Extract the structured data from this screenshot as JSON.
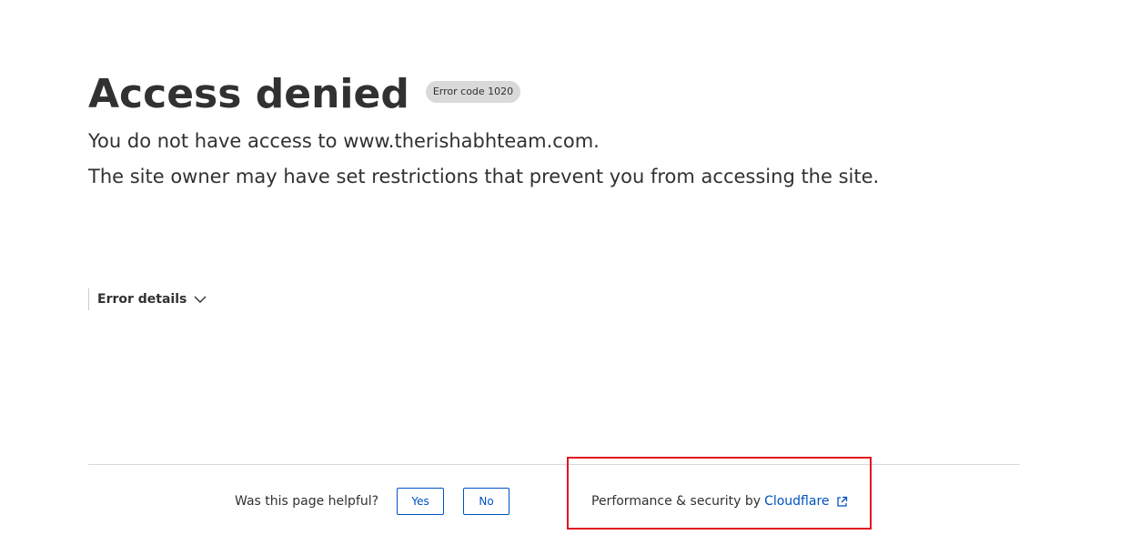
{
  "main": {
    "title": "Access denied",
    "error_badge": "Error code 1020",
    "message_line1": "You do not have access to www.therishabhteam.com.",
    "message_line2": "The site owner may have set restrictions that prevent you from accessing the site."
  },
  "details": {
    "label": "Error details",
    "icon": "chevron-down-icon"
  },
  "footer": {
    "helpful_question": "Was this page helpful?",
    "yes_label": "Yes",
    "no_label": "No",
    "performance_prefix": "Performance & security by",
    "cloudflare_link": "Cloudflare",
    "external_icon": "external-link-icon"
  },
  "colors": {
    "text": "#313131",
    "link_blue": "#0051c3",
    "badge_bg": "#d9d9d9",
    "annotation_red": "#e0161f"
  }
}
